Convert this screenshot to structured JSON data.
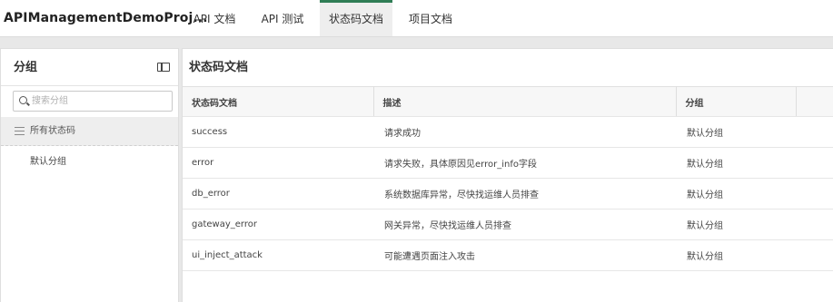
{
  "header": {
    "app_title": "APIManagementDemoProj...",
    "tabs": [
      {
        "label": "API 文档",
        "active": false
      },
      {
        "label": "API 测试",
        "active": false
      },
      {
        "label": "状态码文档",
        "active": true
      },
      {
        "label": "项目文档",
        "active": false
      }
    ],
    "active_color": "#2f7d55"
  },
  "sidebar": {
    "title": "分组",
    "search_placeholder": "搜索分组",
    "search_value": "",
    "all_label": "所有状态码",
    "groups": [
      {
        "label": "默认分组"
      }
    ]
  },
  "main": {
    "title": "状态码文档",
    "columns": [
      "状态码文档",
      "描述",
      "分组"
    ],
    "rows": [
      {
        "code": "success",
        "description": "请求成功",
        "group": "默认分组"
      },
      {
        "code": "error",
        "description": "请求失败，具体原因见error_info字段",
        "group": "默认分组"
      },
      {
        "code": "db_error",
        "description": "系统数据库异常，尽快找运维人员排查",
        "group": "默认分组"
      },
      {
        "code": "gateway_error",
        "description": "网关异常，尽快找运维人员排查",
        "group": "默认分组"
      },
      {
        "code": "ui_inject_attack",
        "description": "可能遭遇页面注入攻击",
        "group": "默认分组"
      }
    ]
  }
}
